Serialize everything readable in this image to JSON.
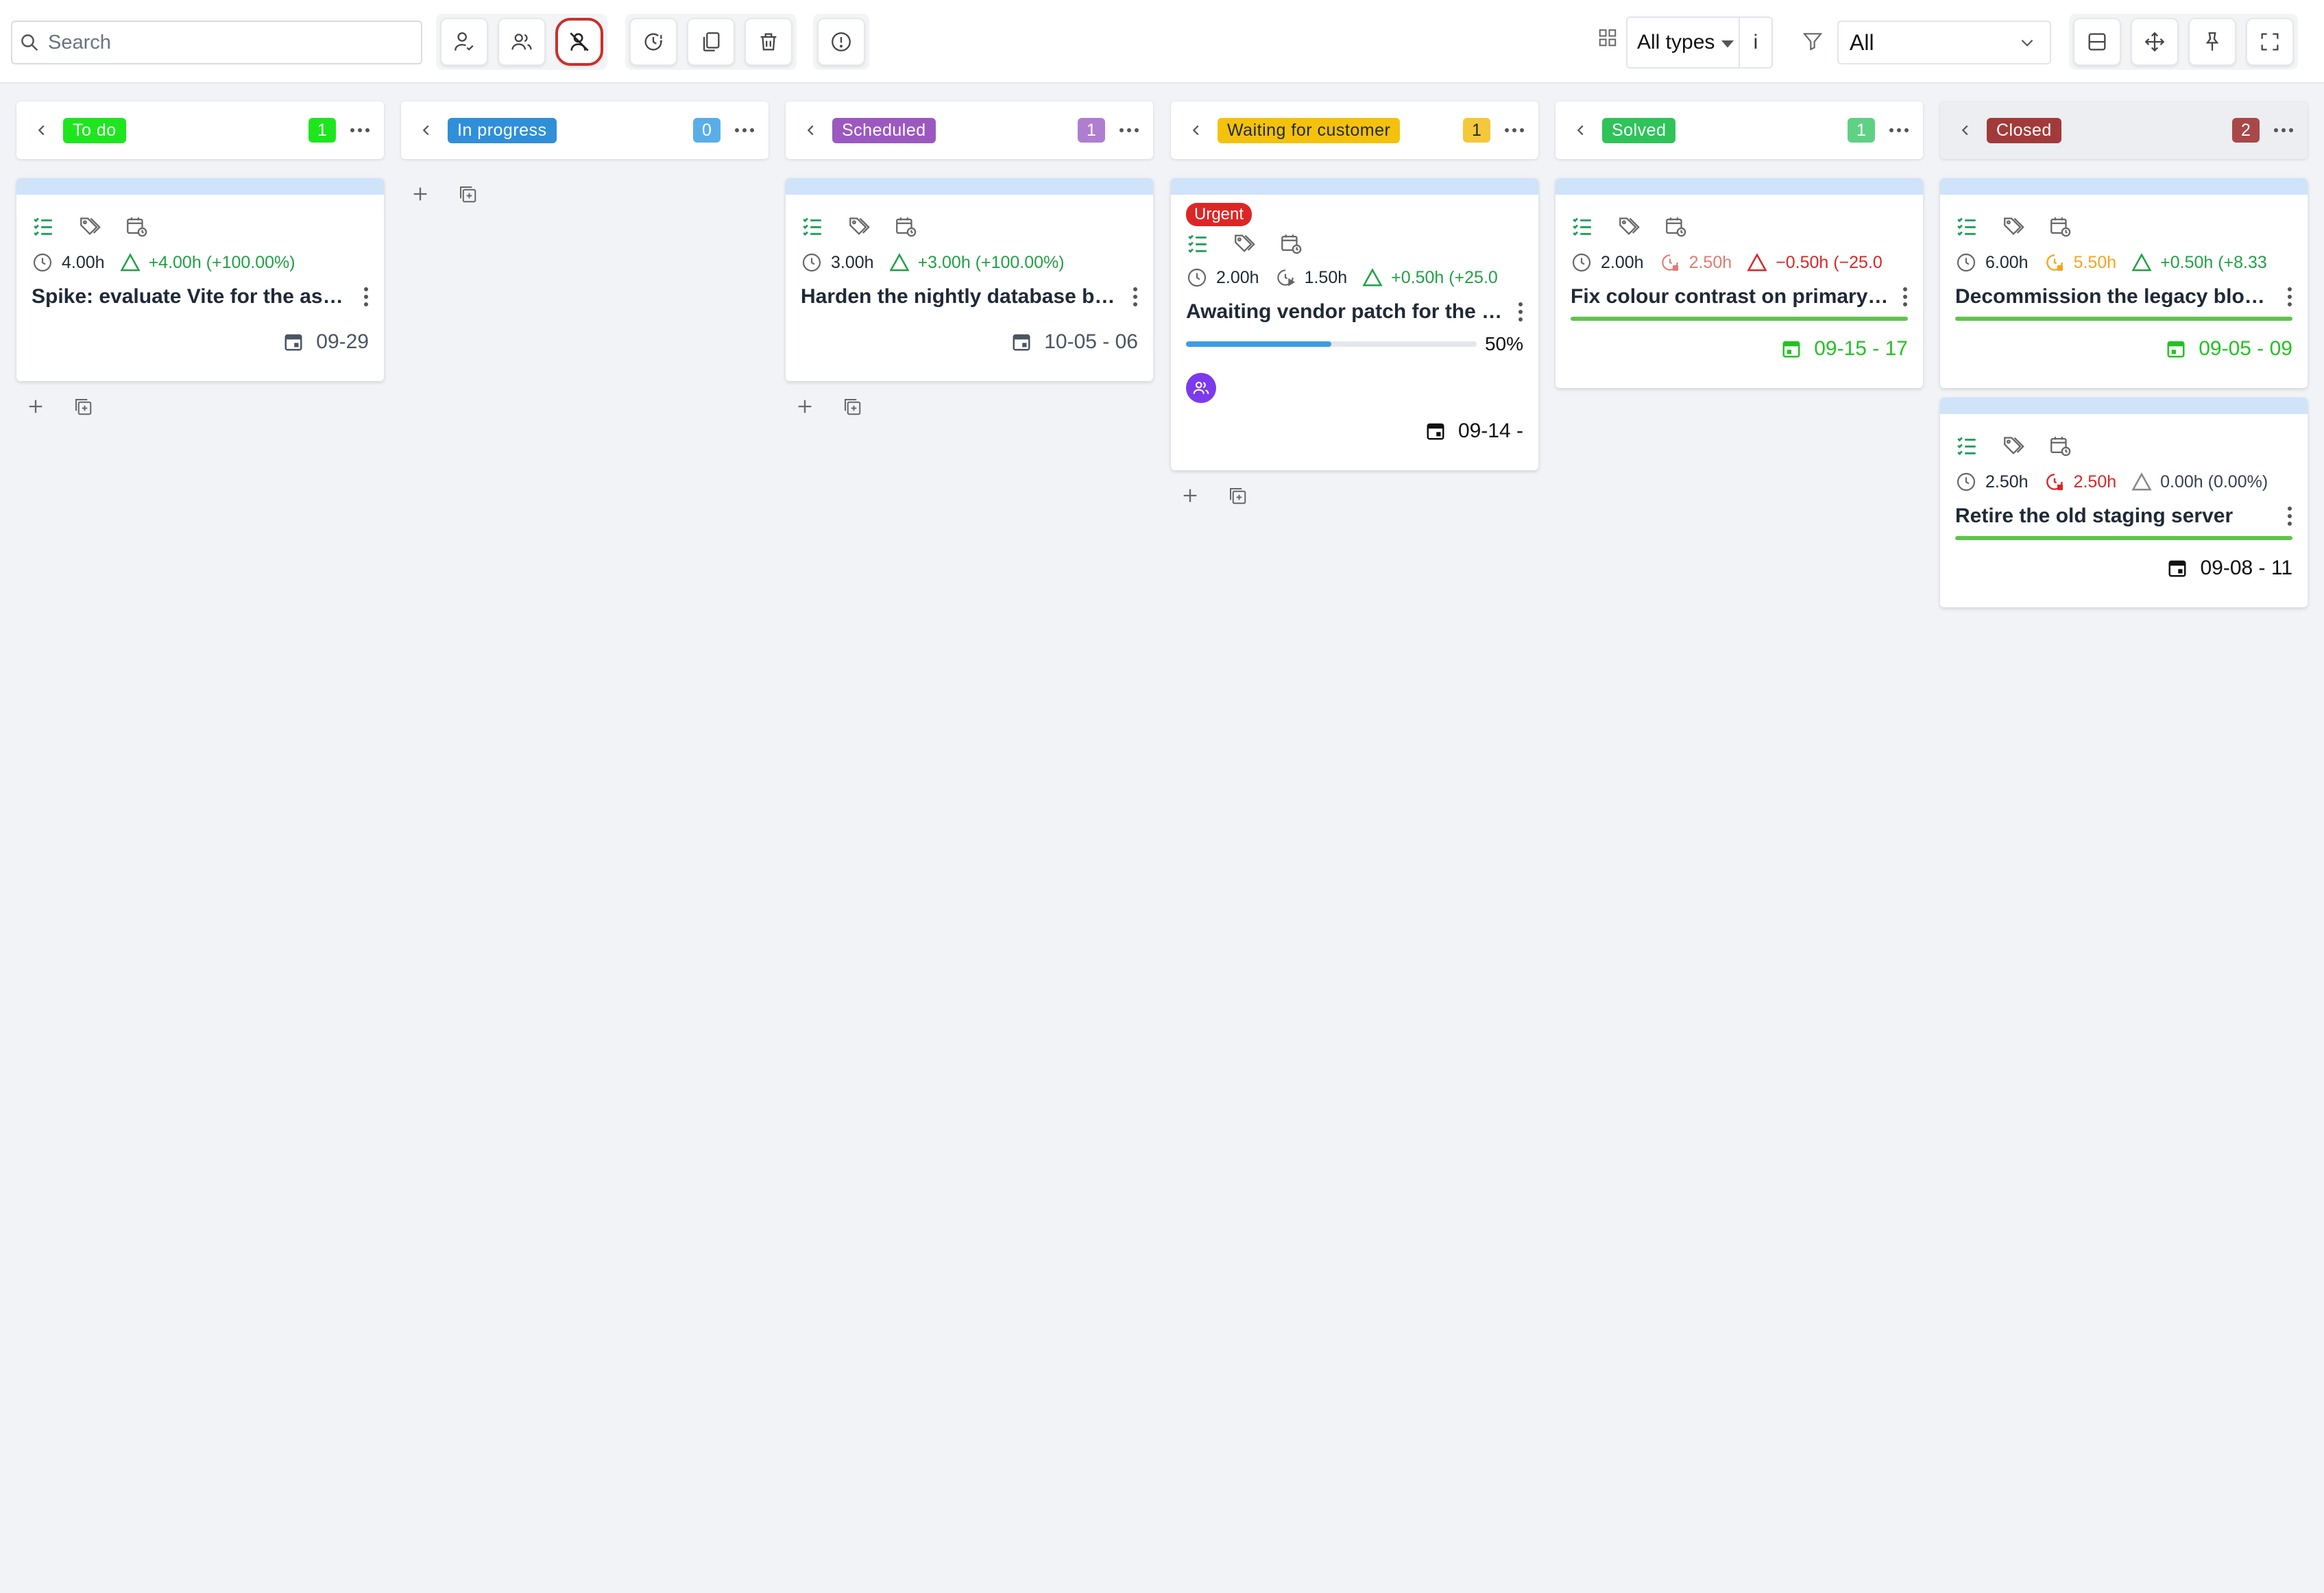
{
  "search": {
    "placeholder": "Search"
  },
  "filters": {
    "types_value": "All types",
    "types_info": "i",
    "status_value": "All"
  },
  "colors": {
    "todo": "#1ee61e",
    "in_progress": "#2f8fd8",
    "scheduled": "#9b59c0",
    "waiting": "#f4c20d",
    "solved": "#2fc35a",
    "closed": "#a33a3a",
    "positive": "#22a046",
    "negative": "#dc2626",
    "warning": "#f5a524"
  },
  "columns": [
    {
      "label": "To do",
      "count": "1",
      "cards": [
        {
          "estimate": "4.00h",
          "delta": "+4.00h (+100.00%)",
          "title": "Spike: evaluate Vite for the asset pipeline",
          "date": "09-29"
        }
      ]
    },
    {
      "label": "In progress",
      "count": "0",
      "cards": []
    },
    {
      "label": "Scheduled",
      "count": "1",
      "cards": [
        {
          "estimate": "3.00h",
          "delta": "+3.00h (+100.00%)",
          "title": "Harden the nightly database backup job",
          "date": "10-05 - 06"
        }
      ]
    },
    {
      "label": "Waiting for customer",
      "count": "1",
      "cards": [
        {
          "tag": "Urgent",
          "estimate": "2.00h",
          "spent": "1.50h",
          "delta": "+0.50h (+25.0",
          "title": "Awaiting vendor patch for the payment gateway",
          "progress": "50%",
          "progress_value": 50,
          "date": "09-14 -"
        }
      ]
    },
    {
      "label": "Solved",
      "count": "1",
      "cards": [
        {
          "estimate": "2.00h",
          "spent": "2.50h",
          "delta": "−0.50h (−25.0",
          "title": "Fix colour contrast on primary buttons",
          "date": "09-15 - 17"
        }
      ]
    },
    {
      "label": "Closed",
      "count": "2",
      "cards": [
        {
          "estimate": "6.00h",
          "spent": "5.50h",
          "delta": "+0.50h (+8.33",
          "title": "Decommission the legacy blog app",
          "date": "09-05 - 09"
        },
        {
          "estimate": "2.50h",
          "spent": "2.50h",
          "delta": "0.00h (0.00%)",
          "title": "Retire the old staging server",
          "date": "09-08 - 11"
        }
      ]
    }
  ]
}
